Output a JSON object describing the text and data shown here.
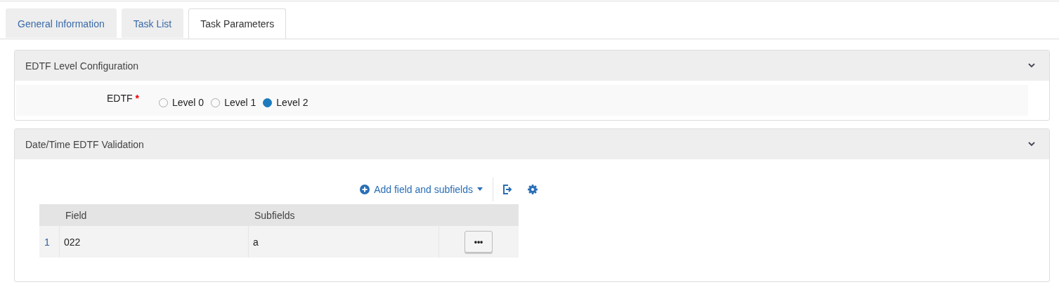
{
  "tabs": [
    {
      "label": "General Information",
      "selected": false
    },
    {
      "label": "Task List",
      "selected": false
    },
    {
      "label": "Task Parameters",
      "selected": true
    }
  ],
  "sections": [
    {
      "title": "EDTF Level Configuration",
      "expanded": true,
      "kind": "radio",
      "field": {
        "label": "EDTF",
        "required_mark": "*",
        "options": [
          {
            "label": "Level 0",
            "selected": false
          },
          {
            "label": "Level 1",
            "selected": false
          },
          {
            "label": "Level 2",
            "selected": true
          }
        ]
      }
    },
    {
      "title": "Date/Time EDTF Validation",
      "expanded": true,
      "kind": "table",
      "toolbar": {
        "add_label": "Add field and subfields"
      },
      "table": {
        "columns": [
          "Field",
          "Subfields"
        ],
        "rows": [
          {
            "index": "1",
            "cells": [
              "022",
              "a"
            ],
            "action": "•••"
          }
        ]
      }
    }
  ]
}
